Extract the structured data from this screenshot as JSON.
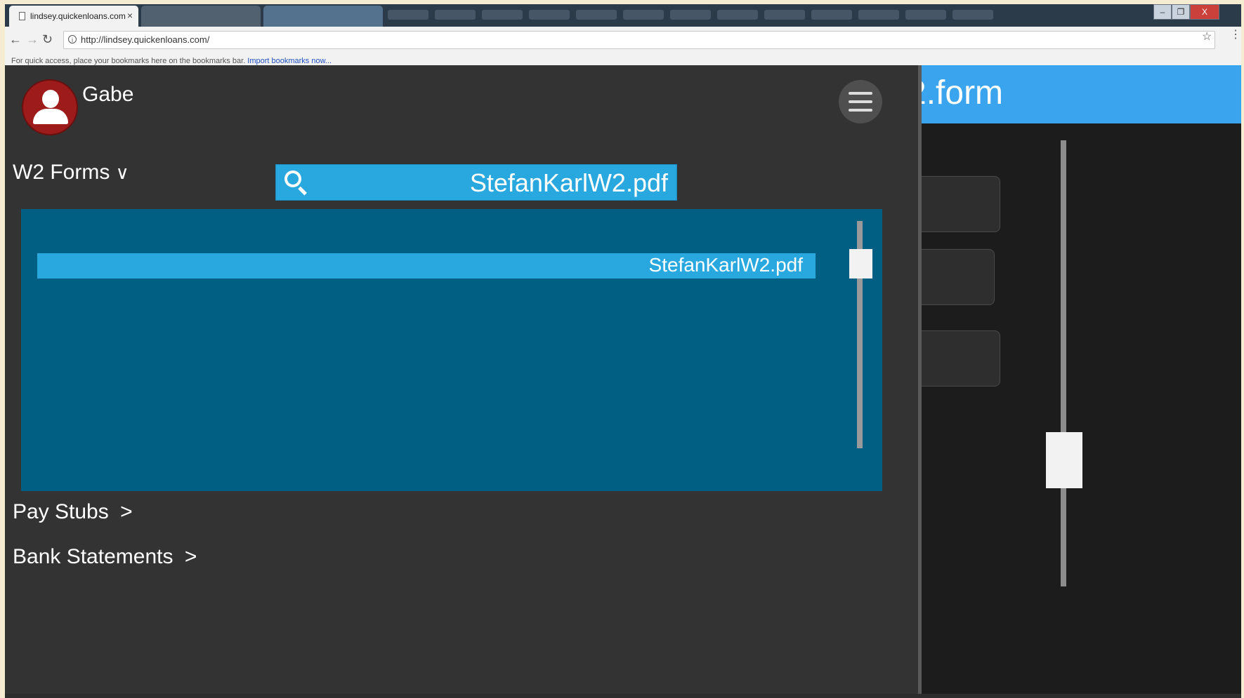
{
  "browser": {
    "active_tab_title": "lindsey.quickenloans.com",
    "tab_close": "×",
    "url": "http://lindsey.quickenloans.com/",
    "bookmarks_hint": "For quick access, place your bookmarks here on the bookmarks bar.",
    "import_bookmarks": "Import bookmarks now...",
    "nav_back": "←",
    "nav_forward": "→",
    "nav_reload": "↻",
    "bookmark_star": "☆",
    "menu": "⋮",
    "info": "i",
    "win_minimize": "–",
    "win_maximize": "❐",
    "win_close": "X"
  },
  "user": {
    "name": "Gabe"
  },
  "sections": {
    "w2": {
      "label": "W2 Forms",
      "chevron": "∨"
    },
    "pay_stubs": {
      "label": "Pay Stubs",
      "chevron": ">"
    },
    "bank": {
      "label": "Bank Statements",
      "chevron": ">"
    }
  },
  "search": {
    "value": "StefanKarlW2.pdf"
  },
  "results": [
    {
      "filename": "StefanKarlW2.pdf"
    }
  ],
  "preview": {
    "title_partial": "2.form"
  },
  "colors": {
    "app_bg": "#333333",
    "accent": "#29a8e0",
    "results_bg": "#005f82",
    "avatar": "#9e1b1b",
    "preview_header": "#3ba4ee"
  },
  "icons": {
    "search": "search-icon",
    "menu": "hamburger-menu-icon",
    "avatar": "user-avatar-icon"
  }
}
